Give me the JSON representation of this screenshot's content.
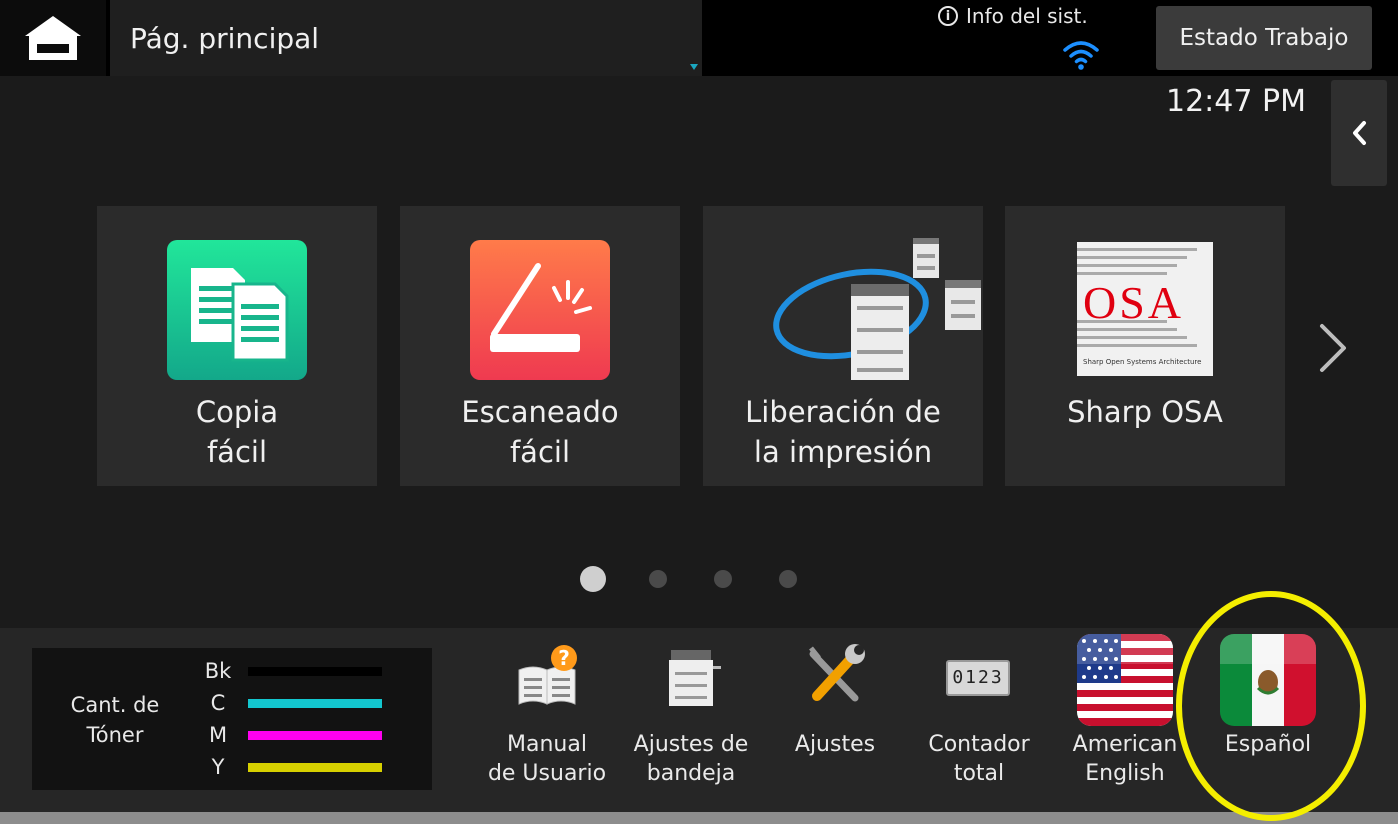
{
  "header": {
    "title": "Pág. principal",
    "system_info": "Info del sist.",
    "job_status": "Estado Trabajo",
    "time": "12:47 PM"
  },
  "apps": [
    {
      "label": "Copia\nfácil",
      "icon": "copy-icon",
      "color": "#1fc48c"
    },
    {
      "label": "Escaneado\nfácil",
      "icon": "scanner-icon",
      "color": "#f2554a"
    },
    {
      "label": "Liberación de\nla impresión",
      "icon": "print-release-icon"
    },
    {
      "label": "Sharp OSA",
      "icon": "osa-logo"
    }
  ],
  "osa_logo": {
    "big": "OSA",
    "small": "Sharp Open Systems Architecture"
  },
  "pagination": {
    "pages": 4,
    "current": 1
  },
  "toner": {
    "title": "Cant. de\nTóner",
    "items": [
      {
        "label": "Bk",
        "color": "#000000",
        "level": 1.0
      },
      {
        "label": "C",
        "color": "#13c7cf",
        "level": 1.0
      },
      {
        "label": "M",
        "color": "#ff00f0",
        "level": 1.0
      },
      {
        "label": "Y",
        "color": "#d7d000",
        "level": 1.0
      }
    ]
  },
  "tools": [
    {
      "label": "Manual\nde Usuario",
      "icon": "user-manual-icon"
    },
    {
      "label": "Ajustes de\nbandeja",
      "icon": "tray-settings-icon"
    },
    {
      "label": "Ajustes",
      "icon": "settings-tools-icon"
    },
    {
      "label": "Contador\ntotal",
      "icon": "counter-icon"
    }
  ],
  "counter_digits": "0123",
  "languages": [
    {
      "label": "American\nEnglish",
      "flag": "us-flag-icon"
    },
    {
      "label": "Español",
      "flag": "mexico-flag-icon"
    }
  ],
  "highlight_color": "#f4ee00"
}
